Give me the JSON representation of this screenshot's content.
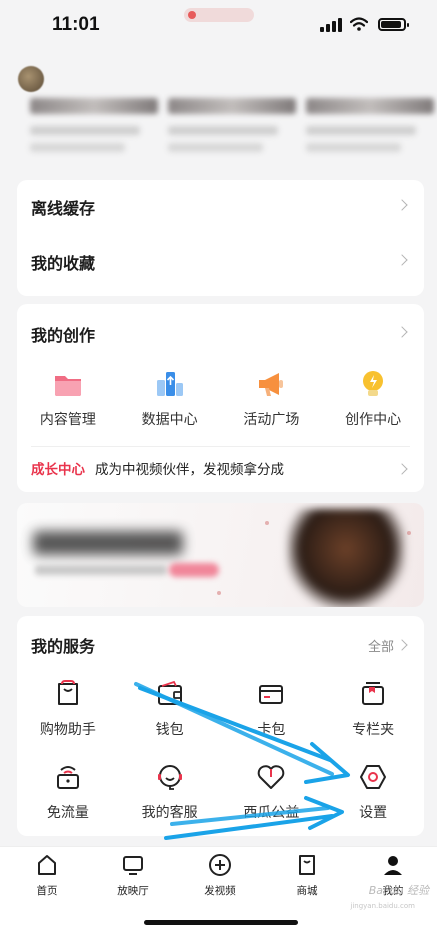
{
  "status_bar": {
    "time": "11:01"
  },
  "list": {
    "offline_cache": "离线缓存",
    "favorites": "我的收藏"
  },
  "creation": {
    "title": "我的创作",
    "items": [
      {
        "label": "内容管理",
        "icon": "folder-icon"
      },
      {
        "label": "数据中心",
        "icon": "data-center-icon"
      },
      {
        "label": "活动广场",
        "icon": "megaphone-icon"
      },
      {
        "label": "创作中心",
        "icon": "lightbulb-icon"
      }
    ],
    "growth_label": "成长中心",
    "growth_text": "成为中视频伙伴，发视频拿分成"
  },
  "services": {
    "title": "我的服务",
    "more": "全部",
    "items": [
      {
        "label": "购物助手",
        "icon": "shopping-bag-icon"
      },
      {
        "label": "钱包",
        "icon": "wallet-icon"
      },
      {
        "label": "卡包",
        "icon": "card-icon"
      },
      {
        "label": "专栏夹",
        "icon": "column-folder-icon"
      },
      {
        "label": "免流量",
        "icon": "free-data-icon"
      },
      {
        "label": "我的客服",
        "icon": "customer-service-icon"
      },
      {
        "label": "西瓜公益",
        "icon": "charity-heart-icon"
      },
      {
        "label": "设置",
        "icon": "settings-icon"
      }
    ]
  },
  "tabbar": {
    "items": [
      {
        "label": "首页",
        "icon": "home-icon"
      },
      {
        "label": "放映厅",
        "icon": "tv-icon"
      },
      {
        "label": "发视频",
        "icon": "add-icon"
      },
      {
        "label": "商城",
        "icon": "store-icon"
      },
      {
        "label": "我的",
        "icon": "profile-icon"
      }
    ]
  },
  "watermark": {
    "brand": "Bai du 经验",
    "url": "jingyan.baidu.com"
  },
  "colors": {
    "accent_red": "#e9344c",
    "arrow_blue": "#1aa3e8",
    "background": "#f4f4f5"
  }
}
